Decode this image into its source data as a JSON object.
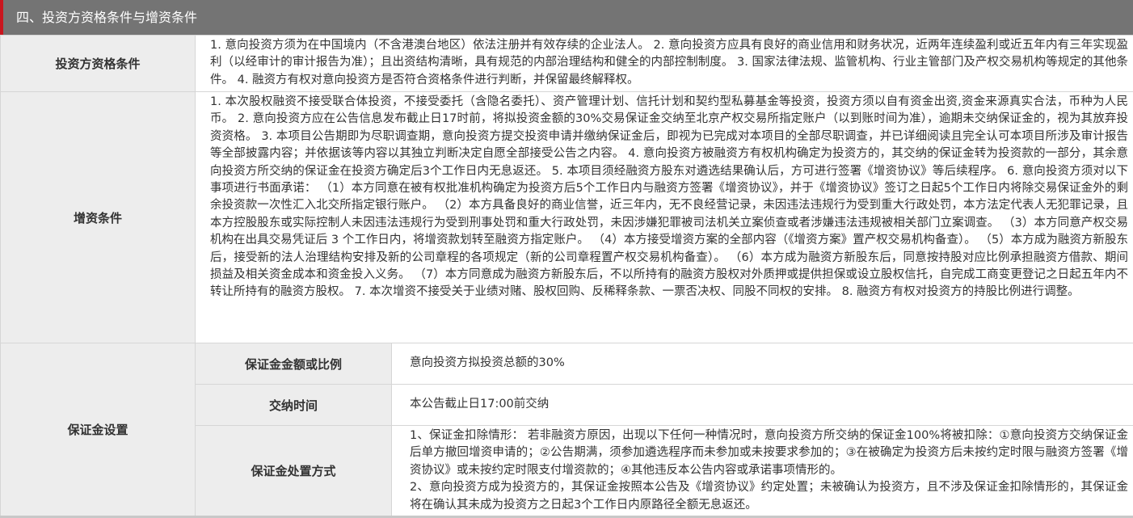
{
  "section": {
    "title": "四、投资方资格条件与增资条件"
  },
  "rows": {
    "qualification": {
      "label": "投资方资格条件",
      "text": "1. 意向投资方须为在中国境内（不含港澳台地区）依法注册并有效存续的企业法人。 2. 意向投资方应具有良好的商业信用和财务状况，近两年连续盈利或近五年内有三年实现盈利（以经审计的审计报告为准）；且出资结构清晰，具有规范的内部治理结构和健全的内部控制制度。 3. 国家法律法规、监管机构、行业主管部门及产权交易机构等规定的其他条件。 4. 融资方有权对意向投资方是否符合资格条件进行判断，并保留最终解释权。"
    },
    "capital_increase": {
      "label": "增资条件",
      "text": "1. 本次股权融资不接受联合体投资，不接受委托（含隐名委托）、资产管理计划、信托计划和契约型私募基金等投资，投资方须以自有资金出资,资金来源真实合法，币种为人民币。 2. 意向投资方应在公告信息发布截止日17时前，将拟投资金额的30%交易保证金交纳至北京产权交易所指定账户（以到账时间为准），逾期未交纳保证金的，视为其放弃投资资格。 3. 本项目公告期即为尽职调查期，意向投资方提交投资申请并缴纳保证金后，即视为已完成对本项目的全部尽职调查，并已详细阅读且完全认可本项目所涉及审计报告等全部披露内容；并依据该等内容以其独立判断决定自愿全部接受公告之内容。 4. 意向投资方被融资方有权机构确定为投资方的，其交纳的保证金转为投资款的一部分，其余意向投资方所交纳的保证金在投资方确定后3个工作日内无息返还。 5. 本项目须经融资方股东对遴选结果确认后，方可进行签署《增资协议》等后续程序。 6. 意向投资方须对以下事项进行书面承诺： （1）本方同意在被有权批准机构确定为投资方后5个工作日内与融资方签署《增资协议》，并于《增资协议》签订之日起5个工作日内将除交易保证金外的剩余投资款一次性汇入北交所指定银行账户。 （2）本方具备良好的商业信誉，近三年内，无不良经营记录，未因违法违规行为受到重大行政处罚，本方法定代表人无犯罪记录，且本方控股股东或实际控制人未因违法违规行为受到刑事处罚和重大行政处罚，未因涉嫌犯罪被司法机关立案侦查或者涉嫌违法违规被相关部门立案调查。 （3）本方同意产权交易机构在出具交易凭证后 3 个工作日内，将增资款划转至融资方指定账户。 （4）本方接受增资方案的全部内容（《增资方案》置产权交易机构备查）。 （5）本方成为融资方新股东后，接受新的法人治理结构安排及新的公司章程的各项规定（新的公司章程置产权交易机构备查）。 （6）本方成为融资方新股东后，同意按持股对应比例承担融资方借款、期间损益及相关资金成本和资金投入义务。 （7）本方同意成为融资方新股东后，不以所持有的融资方股权对外质押或提供担保或设立股权信托，自完成工商变更登记之日起五年内不转让所持有的融资方股权。 7. 本次增资不接受关于业绩对赌、股权回购、反稀释条款、一票否决权、同股不同权的安排。 8. 融资方有权对投资方的持股比例进行调整。"
    },
    "deposit": {
      "label": "保证金设置",
      "items": [
        {
          "label": "保证金金额或比例",
          "value": "意向投资方拟投资总额的30%"
        },
        {
          "label": "交纳时间",
          "value": "本公告截止日17:00前交纳"
        },
        {
          "label": "保证金处置方式",
          "paragraphs": [
            "1、保证金扣除情形： 若非融资方原因，出现以下任何一种情况时，意向投资方所交纳的保证金100%将被扣除：①意向投资方交纳保证金后单方撤回增资申请的；②公告期满，须参加遴选程序而未参加或未按要求参加的；③在被确定为投资方后未按约定时限与融资方签署《增资协议》或未按约定时限支付增资款的；④其他违反本公告内容或承诺事项情形的。",
            "2、意向投资方成为投资方的，其保证金按照本公告及《增资协议》约定处置；未被确认为投资方，且不涉及保证金扣除情形的，其保证金将在确认其未成为投资方之日起3个工作日内原路径全额无息返还。"
          ]
        }
      ]
    }
  },
  "colors": {
    "header_bg": "#747474",
    "header_accent": "#c9151e",
    "label_bg": "#ededed",
    "border": "#d6d6d6"
  }
}
